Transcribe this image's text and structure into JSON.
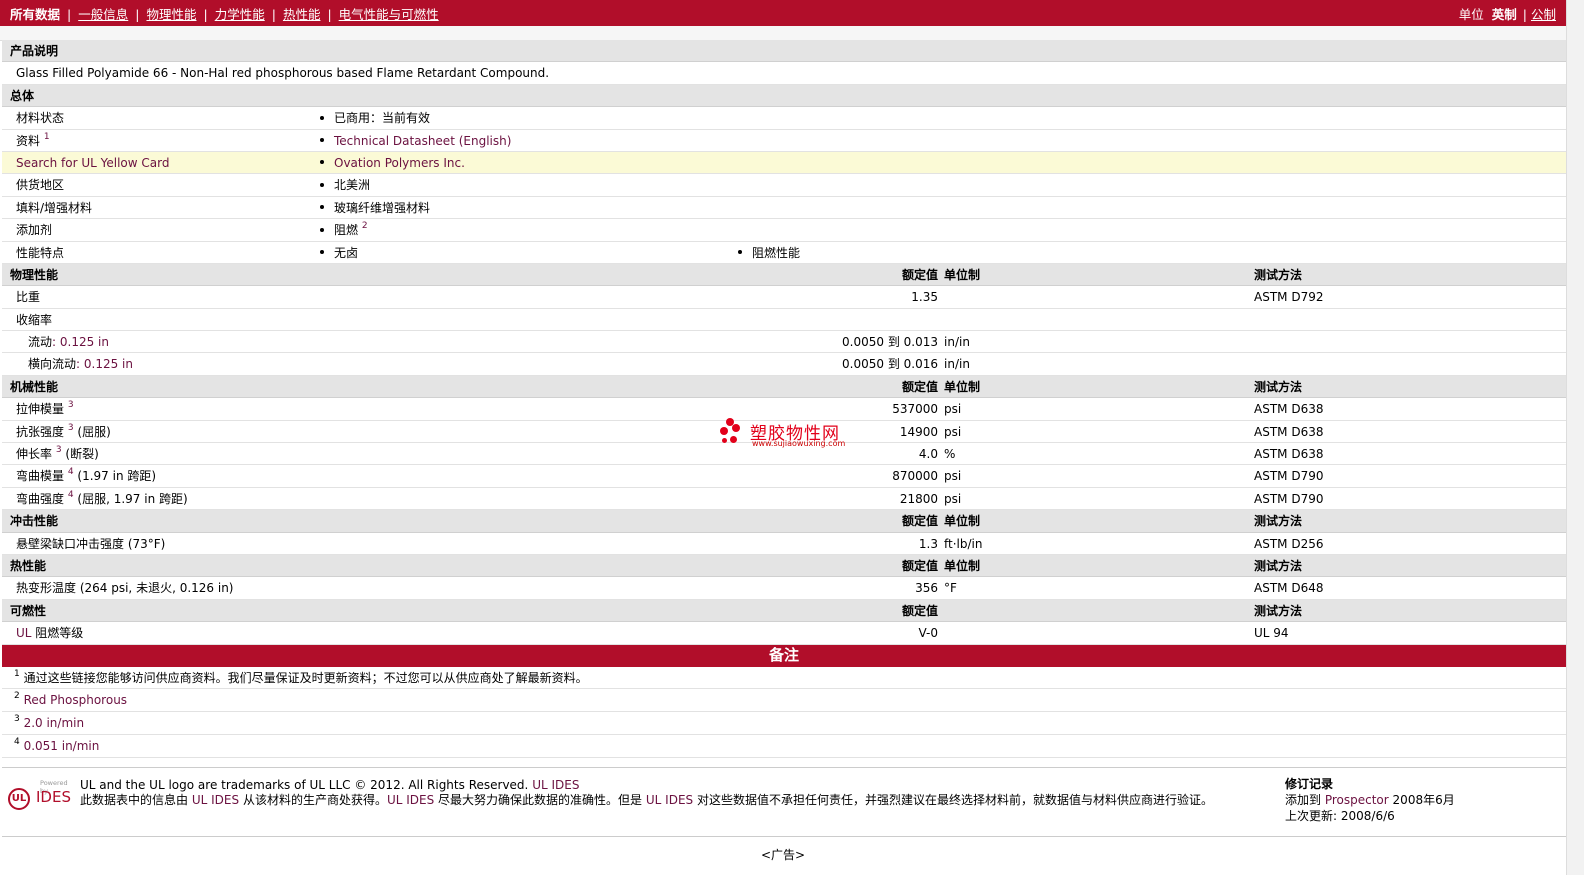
{
  "nav": {
    "items": [
      "所有数据",
      "一般信息",
      "物理性能",
      "力学性能",
      "热性能",
      "电气性能与可燃性"
    ],
    "units_label": "单位",
    "units_active": "英制",
    "units_other": "公制"
  },
  "product": {
    "section_title": "产品说明",
    "description": "Glass Filled Polyamide 66 - Non-Hal red phosphorous based Flame Retardant Compound."
  },
  "general": {
    "section_title": "总体",
    "rows": [
      {
        "label": "材料状态",
        "value": "已商用：当前有效"
      },
      {
        "label": "资料",
        "sup": "1",
        "value": "Technical Datasheet (English)"
      },
      {
        "label": "Search for UL Yellow Card",
        "value": "Ovation Polymers Inc."
      },
      {
        "label": "供货地区",
        "value": "北美洲"
      },
      {
        "label": "填料/增强材料",
        "value": "玻璃纤维增强材料"
      },
      {
        "label": "添加剂",
        "value": "阻燃",
        "value_sup": "2"
      },
      {
        "label": "性能特点",
        "value": "无卤",
        "value2": "阻燃性能"
      }
    ]
  },
  "headers": {
    "nominal": "额定值",
    "unit": "单位制",
    "method": "测试方法"
  },
  "physical": {
    "section_title": "物理性能",
    "specific_gravity": {
      "label": "比重",
      "value": "1.35",
      "method": "ASTM D792"
    },
    "shrinkage": {
      "label": "收缩率"
    },
    "flow": {
      "label": "流动",
      "cond": ": 0.125 in",
      "value": "0.0050 到  0.013",
      "unit": "in/in"
    },
    "xflow": {
      "label": "横向流动",
      "cond": ": 0.125 in",
      "value": "0.0050 到  0.016",
      "unit": "in/in"
    }
  },
  "mechanical": {
    "section_title": "机械性能",
    "rows": [
      {
        "label": "拉伸模量",
        "sup": "3",
        "cond": "",
        "value": "537000",
        "unit": "psi",
        "method": "ASTM D638"
      },
      {
        "label": "抗张强度",
        "sup": "3",
        "cond": " (屈服)",
        "value": "14900",
        "unit": "psi",
        "method": "ASTM D638"
      },
      {
        "label": "伸长率",
        "sup": "3",
        "cond": " (断裂)",
        "value": "4.0",
        "unit": "%",
        "method": "ASTM D638"
      },
      {
        "label": "弯曲模量",
        "sup": "4",
        "cond": " (1.97 in 跨距)",
        "value": "870000",
        "unit": "psi",
        "method": "ASTM D790"
      },
      {
        "label": "弯曲强度",
        "sup": "4",
        "cond": " (屈服, 1.97 in 跨距)",
        "value": "21800",
        "unit": "psi",
        "method": "ASTM D790"
      }
    ]
  },
  "impact": {
    "section_title": "冲击性能",
    "row": {
      "label": "悬壁梁缺口冲击强度",
      "cond": " (73°F)",
      "value": "1.3",
      "unit": "ft·lb/in",
      "method": "ASTM D256"
    }
  },
  "thermal": {
    "section_title": "热性能",
    "row": {
      "label": "热变形温度",
      "cond": " (264 psi, 未退火, 0.126 in)",
      "value": "356",
      "unit": "°F",
      "method": "ASTM D648"
    }
  },
  "flammability": {
    "section_title": "可燃性",
    "row": {
      "label_a": "UL",
      "label_b": " 阻燃等级",
      "value": "V-0",
      "method": "UL 94"
    }
  },
  "notes": {
    "title": "备注",
    "items": [
      {
        "num": "1",
        "text": "通过这些链接您能够访问供应商资料。我们尽量保证及时更新资料；不过您可以从供应商处了解最新资料。"
      },
      {
        "num": "2",
        "text": "Red Phosphorous"
      },
      {
        "num": "3",
        "text": "2.0 in/min"
      },
      {
        "num": "4",
        "text": "0.051 in/min"
      }
    ]
  },
  "footer": {
    "logo_powered": "Powered by",
    "logo_ul": "UL",
    "logo_ides": "IDES",
    "trademark": "UL and the UL logo are trademarks of UL LLC © 2012. All Rights Reserved.",
    "trademark_link": "UL IDES",
    "disc_1": "此数据表中的信息由",
    "disc_link1": "UL IDES",
    "disc_2": "从该材料的生产商处获得。",
    "disc_link2": "UL IDES",
    "disc_3": "尽最大努力确保此数据的准确性。但是",
    "disc_link3": "UL IDES",
    "disc_4": "对这些数据值不承担任何责任，并强烈建议在最终选择材料前，就数据值与材料供应商进行验证。",
    "rev_title": "修订记录",
    "added_label": "添加到",
    "added_link": "Prospector",
    "added_date": "2008年6月",
    "updated_label": "上次更新:",
    "updated_date": "2008/6/6"
  },
  "watermark": {
    "cn": "塑胶物性网",
    "url": "www.sujiaowuxing.com"
  },
  "ad": "<广告>"
}
